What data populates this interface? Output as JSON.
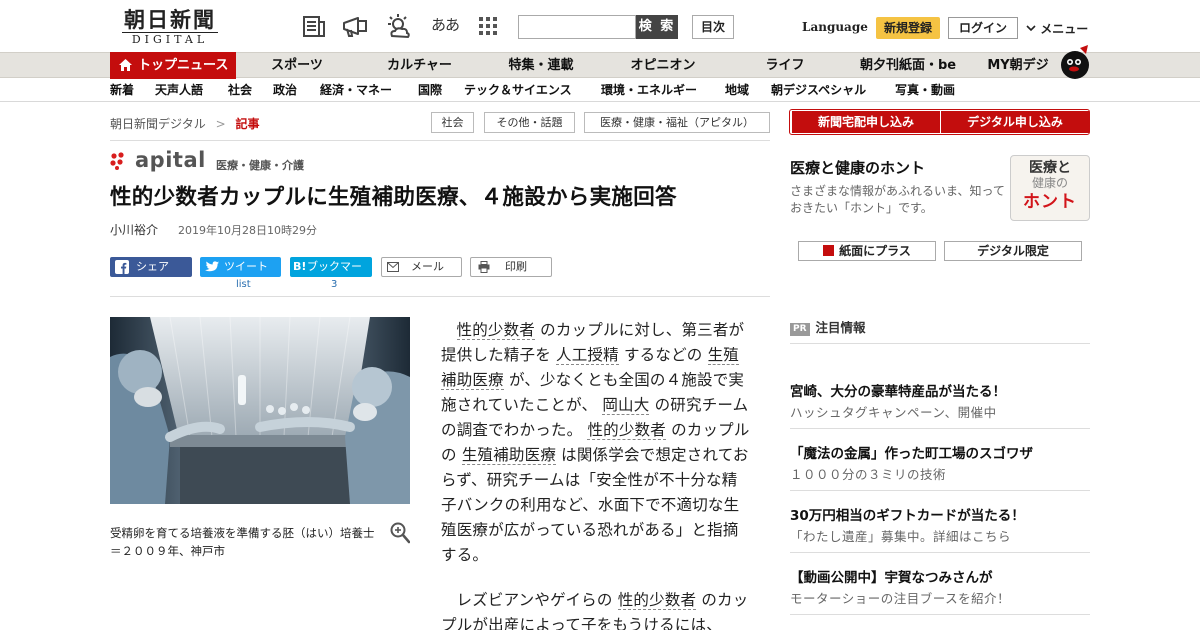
{
  "header": {
    "logo_main": "朝日新聞",
    "logo_sub": "DIGITAL",
    "icons": [
      "newspaper-icon",
      "megaphone-icon",
      "weather-icon",
      "font-size-icon",
      "grid-icon"
    ],
    "font_size_glyph": "ああ",
    "search_button": "検 索",
    "search_placeholder": "",
    "mokuji": "目次",
    "language": "Language",
    "signup": "新規登録",
    "login": "ログイン",
    "menu": "メニュー"
  },
  "gnav": {
    "top": "トップニュース",
    "items": [
      "スポーツ",
      "カルチャー",
      "特集・連載",
      "オピニオン",
      "ライフ",
      "朝夕刊紙面・be",
      "MY朝デジ"
    ]
  },
  "subnav": {
    "items": [
      "新着",
      "天声人語",
      "社会",
      "政治",
      "経済・マネー",
      "国際",
      "テック＆サイエンス",
      "環境・エネルギー",
      "地域",
      "朝デジスペシャル",
      "写真・動画"
    ]
  },
  "breadcrumb": {
    "home": "朝日新聞デジタル",
    "sep": ">",
    "current": "記事"
  },
  "tags": [
    "社会",
    "その他・話題",
    "医療・健康・福祉（アピタル）"
  ],
  "article": {
    "brand": "apital",
    "brand_sub": "医療・健康・介護",
    "headline": "性的少数者カップルに生殖補助医療、４施設から実施回答",
    "author": "小川裕介",
    "date": "2019年10月28日10時29分",
    "share": {
      "facebook": "シェア",
      "twitter": "ツイート",
      "hatena": "ブックマーク",
      "mail": "メール",
      "print": "印刷",
      "twitter_count": "list",
      "hatena_count": "3"
    },
    "caption": "受精卵を育てる培養液を準備する胚（はい）培養士＝２００９年、神戸市",
    "p1": [
      {
        "t": "性的少数者",
        "k": true
      },
      {
        "t": " のカップルに対し、第三者が提供した精子を ",
        "k": false
      },
      {
        "t": "人工授精",
        "k": true
      },
      {
        "t": " するなどの ",
        "k": false
      },
      {
        "t": "生殖補助医療",
        "k": true
      },
      {
        "t": " が、少なくとも全国の４施設で実施されていたことが、 ",
        "k": false
      },
      {
        "t": "岡山大",
        "k": true
      },
      {
        "t": " の研究チームの調査でわかった。 ",
        "k": false
      },
      {
        "t": "性的少数者",
        "k": true
      },
      {
        "t": " のカップルの ",
        "k": false
      },
      {
        "t": "生殖補助医療",
        "k": true
      },
      {
        "t": " は関係学会で想定されておらず、研究チームは「安全性が不十分な精子バンクの利用など、水面下で不適切な生殖医療が広がっている恐れがある」と指摘する。",
        "k": false
      }
    ],
    "p2": [
      {
        "t": "レズビアンやゲイらの ",
        "k": false
      },
      {
        "t": "性的少数者",
        "k": true
      },
      {
        "t": " のカップルが出産によって子をもうけるには、",
        "k": false
      }
    ]
  },
  "sidebar": {
    "btn_home": "新聞宅配申し込み",
    "btn_digital": "デジタル申し込み",
    "honto_title": "医療と健康のホント",
    "honto_desc": "さまざまな情報があふれるいま、知っておきたい「ホント」です。",
    "honto_logo_1": "医療と",
    "honto_logo_2": "健康の",
    "honto_logo_3": "ホント",
    "btn_paper": "紙面にプラス",
    "btn_limited": "デジタル限定",
    "pr_badge": "PR",
    "pr_head": "注目情報",
    "pr_items": [
      {
        "title": "宮崎、大分の豪華特産品が当たる！",
        "sub": "ハッシュタグキャンペーン、開催中"
      },
      {
        "title": "「魔法の金属」作った町工場のスゴワザ",
        "sub": "１０００分の３ミリの技術"
      },
      {
        "title": "30万円相当のギフトカードが当たる！",
        "sub": "「わたし遺産」募集中。詳細はこちら"
      },
      {
        "title": "【動画公開中】宇賀なつみさんが",
        "sub": "モーターショーの注目ブースを紹介！"
      }
    ]
  },
  "colors": {
    "brand_red": "#c40d0d",
    "signup_yellow": "#f5c343",
    "facebook": "#3b5998",
    "twitter": "#1da1f2",
    "hatena": "#00a4de"
  }
}
